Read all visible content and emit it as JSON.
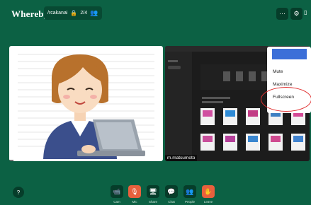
{
  "app": {
    "logo": "Whereby"
  },
  "room": {
    "name": "/rcakanai",
    "count": "2/4"
  },
  "header": {
    "more_icon": "more-icon",
    "settings_icon": "gear-icon"
  },
  "tiles": [
    {
      "name": "   "
    },
    {
      "name": "m.matsumoto"
    }
  ],
  "context_menu": {
    "items": [
      "Mute",
      "Maximize",
      "Fullscreen"
    ]
  },
  "controls": [
    {
      "label": "Cam",
      "icon": "camera-icon"
    },
    {
      "label": "Mic",
      "icon": "mic-off-icon"
    },
    {
      "label": "Share",
      "icon": "screen-share-icon"
    },
    {
      "label": "Chat",
      "icon": "chat-icon"
    },
    {
      "label": "People",
      "icon": "people-icon"
    },
    {
      "label": "Leave",
      "icon": "leave-icon"
    }
  ],
  "colors": {
    "background": "#0c6144",
    "accent": "#e8603d",
    "menu_header": "#3c6fd8",
    "highlight": "#e03030"
  }
}
